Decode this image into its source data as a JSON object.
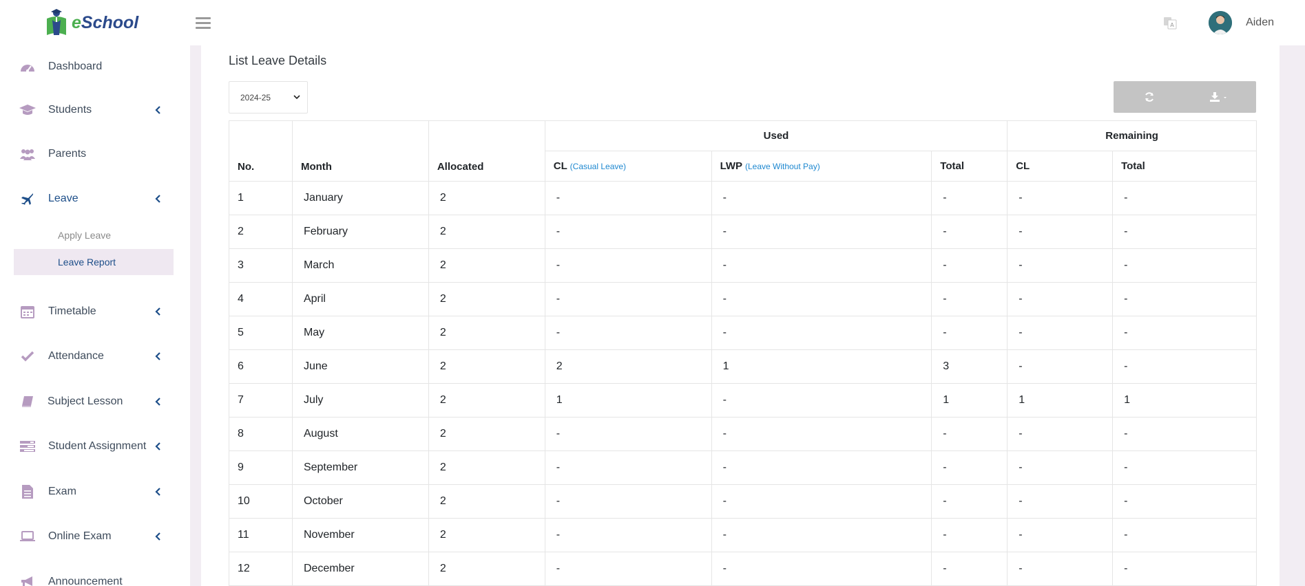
{
  "brand": {
    "name_prefix": "e",
    "name_suffix": "School"
  },
  "header": {
    "user_name": "Aiden"
  },
  "sidebar": {
    "items": [
      {
        "label": "Dashboard",
        "icon": "dashboard-icon",
        "has_chevron": false
      },
      {
        "label": "Students",
        "icon": "graduation-cap-icon",
        "has_chevron": true
      },
      {
        "label": "Parents",
        "icon": "users-icon",
        "has_chevron": false
      },
      {
        "label": "Leave",
        "icon": "plane-icon",
        "has_chevron": true,
        "active": true
      },
      {
        "label": "Timetable",
        "icon": "calendar-icon",
        "has_chevron": true
      },
      {
        "label": "Attendance",
        "icon": "check-icon",
        "has_chevron": true
      },
      {
        "label": "Subject Lesson",
        "icon": "book-icon",
        "has_chevron": true
      },
      {
        "label": "Student Assignment",
        "icon": "tasks-icon",
        "has_chevron": true
      },
      {
        "label": "Exam",
        "icon": "file-icon",
        "has_chevron": true
      },
      {
        "label": "Online Exam",
        "icon": "laptop-icon",
        "has_chevron": true
      },
      {
        "label": "Announcement",
        "icon": "bullhorn-icon",
        "has_chevron": false
      }
    ],
    "leave_submenu": [
      {
        "label": "Apply Leave"
      },
      {
        "label": "Leave Report",
        "active": true
      }
    ]
  },
  "main": {
    "title": "List Leave Details",
    "session_value": "2024-25",
    "table": {
      "headers": {
        "no": "No.",
        "month": "Month",
        "allocated": "Allocated",
        "used": "Used",
        "remaining": "Remaining",
        "cl": "CL",
        "cl_hint": "(Casual Leave)",
        "lwp": "LWP",
        "lwp_hint": "(Leave Without Pay)",
        "total": "Total",
        "rem_cl": "CL",
        "rem_total": "Total"
      },
      "rows": [
        [
          "1",
          "January",
          "2",
          "-",
          "-",
          "-",
          "-",
          "-"
        ],
        [
          "2",
          "February",
          "2",
          "-",
          "-",
          "-",
          "-",
          "-"
        ],
        [
          "3",
          "March",
          "2",
          "-",
          "-",
          "-",
          "-",
          "-"
        ],
        [
          "4",
          "April",
          "2",
          "-",
          "-",
          "-",
          "-",
          "-"
        ],
        [
          "5",
          "May",
          "2",
          "-",
          "-",
          "-",
          "-",
          "-"
        ],
        [
          "6",
          "June",
          "2",
          "2",
          "1",
          "3",
          "-",
          "-"
        ],
        [
          "7",
          "July",
          "2",
          "1",
          "-",
          "1",
          "1",
          "1"
        ],
        [
          "8",
          "August",
          "2",
          "-",
          "-",
          "-",
          "-",
          "-"
        ],
        [
          "9",
          "September",
          "2",
          "-",
          "-",
          "-",
          "-",
          "-"
        ],
        [
          "10",
          "October",
          "2",
          "-",
          "-",
          "-",
          "-",
          "-"
        ],
        [
          "11",
          "November",
          "2",
          "-",
          "-",
          "-",
          "-",
          "-"
        ],
        [
          "12",
          "December",
          "2",
          "-",
          "-",
          "-",
          "-",
          "-"
        ]
      ]
    }
  },
  "colors": {
    "accent": "#1d4e89",
    "icon": "#b69bc0",
    "hint": "#1e88d0"
  }
}
